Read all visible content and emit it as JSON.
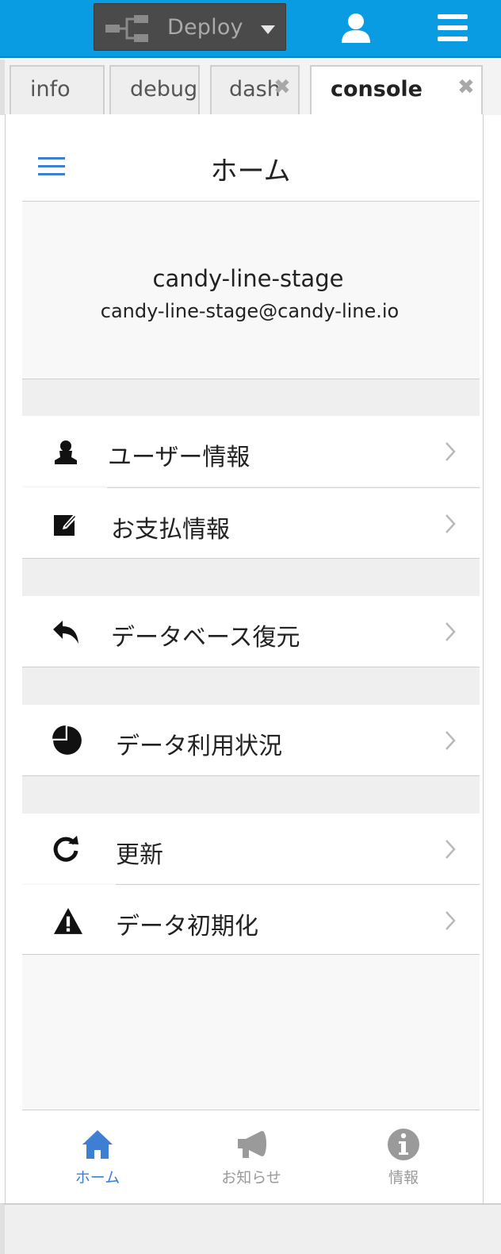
{
  "header": {
    "deploy_label": "Deploy",
    "deploy_icon": "flow-icon",
    "user_icon": "user-icon",
    "menu_icon": "hamburger-icon",
    "bg_color": "#0a9ce2"
  },
  "tabs": [
    {
      "label": "info",
      "active": false
    },
    {
      "label": "debug",
      "active": false
    },
    {
      "label": "dash",
      "active": false,
      "closable": true
    },
    {
      "label": "console",
      "active": true,
      "closable": true
    }
  ],
  "page": {
    "title": "ホーム"
  },
  "profile": {
    "name": "candy-line-stage",
    "email": "candy-line-stage@candy-line.io"
  },
  "menu": {
    "user_info": "ユーザー情報",
    "payment_info": "お支払情報",
    "db_restore": "データベース復元",
    "data_usage": "データ利用状況",
    "refresh": "更新",
    "data_init": "データ初期化"
  },
  "bottom_nav": {
    "home": "ホーム",
    "news": "お知らせ",
    "about": "情報",
    "active_color": "#3f7fd3",
    "inactive_color": "#9a9a9a"
  }
}
